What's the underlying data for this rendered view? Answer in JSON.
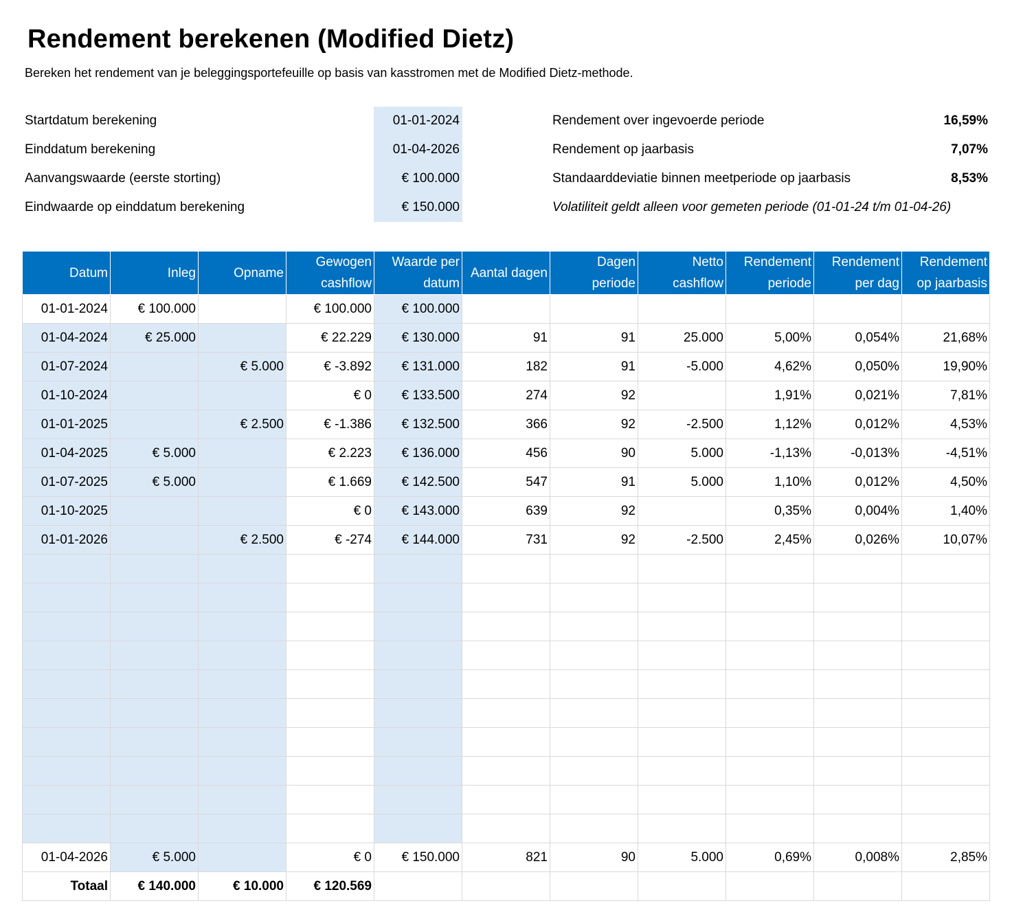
{
  "header": {
    "title": "Rendement berekenen (Modified Dietz)",
    "subtitle": "Bereken het rendement van je beleggingsportefeuille op basis van kasstromen met de Modified Dietz-methode."
  },
  "params": [
    {
      "label": "Startdatum berekening",
      "value": "01-01-2024"
    },
    {
      "label": "Einddatum berekening",
      "value": "01-04-2026"
    },
    {
      "label": "Aanvangswaarde (eerste storting)",
      "value": "€ 100.000"
    },
    {
      "label": "Eindwaarde op einddatum berekening",
      "value": "€ 150.000"
    }
  ],
  "results": [
    {
      "label": "Rendement over ingevoerde periode",
      "value": "16,59%"
    },
    {
      "label": "Rendement op jaarbasis",
      "value": "7,07%"
    },
    {
      "label": "Standaarddeviatie binnen meetperiode op jaarbasis",
      "value": "8,53%"
    }
  ],
  "note": "Volatiliteit geldt alleen voor gemeten periode (01-01-24 t/m 01-04-26)",
  "table": {
    "headers": [
      [
        "Datum"
      ],
      [
        "Inleg"
      ],
      [
        "Opname"
      ],
      [
        "Gewogen",
        "cashflow"
      ],
      [
        "Waarde per",
        "datum"
      ],
      [
        "Aantal dagen"
      ],
      [
        "Dagen",
        "periode"
      ],
      [
        "Netto",
        "cashflow"
      ],
      [
        "Rendement",
        "periode"
      ],
      [
        "Rendement",
        "per dag"
      ],
      [
        "Rendement",
        "op jaarbasis"
      ]
    ],
    "rows": [
      [
        "01-01-2024",
        "€ 100.000",
        "",
        "€ 100.000",
        "€ 100.000",
        "",
        "",
        "",
        "",
        "",
        ""
      ],
      [
        "01-04-2024",
        "€ 25.000",
        "",
        "€ 22.229",
        "€ 130.000",
        "91",
        "91",
        "25.000",
        "5,00%",
        "0,054%",
        "21,68%"
      ],
      [
        "01-07-2024",
        "",
        "€ 5.000",
        "€ -3.892",
        "€ 131.000",
        "182",
        "91",
        "-5.000",
        "4,62%",
        "0,050%",
        "19,90%"
      ],
      [
        "01-10-2024",
        "",
        "",
        "€ 0",
        "€ 133.500",
        "274",
        "92",
        "",
        "1,91%",
        "0,021%",
        "7,81%"
      ],
      [
        "01-01-2025",
        "",
        "€ 2.500",
        "€ -1.386",
        "€ 132.500",
        "366",
        "92",
        "-2.500",
        "1,12%",
        "0,012%",
        "4,53%"
      ],
      [
        "01-04-2025",
        "€ 5.000",
        "",
        "€ 2.223",
        "€ 136.000",
        "456",
        "90",
        "5.000",
        "-1,13%",
        "-0,013%",
        "-4,51%"
      ],
      [
        "01-07-2025",
        "€ 5.000",
        "",
        "€ 1.669",
        "€ 142.500",
        "547",
        "91",
        "5.000",
        "1,10%",
        "0,012%",
        "4,50%"
      ],
      [
        "01-10-2025",
        "",
        "",
        "€ 0",
        "€ 143.000",
        "639",
        "92",
        "",
        "0,35%",
        "0,004%",
        "1,40%"
      ],
      [
        "01-01-2026",
        "",
        "€ 2.500",
        "€ -274",
        "€ 144.000",
        "731",
        "92",
        "-2.500",
        "2,45%",
        "0,026%",
        "10,07%"
      ],
      [
        "",
        "",
        "",
        "",
        "",
        "",
        "",
        "",
        "",
        "",
        ""
      ],
      [
        "",
        "",
        "",
        "",
        "",
        "",
        "",
        "",
        "",
        "",
        ""
      ],
      [
        "",
        "",
        "",
        "",
        "",
        "",
        "",
        "",
        "",
        "",
        ""
      ],
      [
        "",
        "",
        "",
        "",
        "",
        "",
        "",
        "",
        "",
        "",
        ""
      ],
      [
        "",
        "",
        "",
        "",
        "",
        "",
        "",
        "",
        "",
        "",
        ""
      ],
      [
        "",
        "",
        "",
        "",
        "",
        "",
        "",
        "",
        "",
        "",
        ""
      ],
      [
        "",
        "",
        "",
        "",
        "",
        "",
        "",
        "",
        "",
        "",
        ""
      ],
      [
        "",
        "",
        "",
        "",
        "",
        "",
        "",
        "",
        "",
        "",
        ""
      ],
      [
        "",
        "",
        "",
        "",
        "",
        "",
        "",
        "",
        "",
        "",
        ""
      ],
      [
        "",
        "",
        "",
        "",
        "",
        "",
        "",
        "",
        "",
        "",
        ""
      ],
      [
        "01-04-2026",
        "€ 5.000",
        "",
        "€ 0",
        "€ 150.000",
        "821",
        "90",
        "5.000",
        "0,69%",
        "0,008%",
        "2,85%"
      ]
    ],
    "total": [
      "Totaal",
      "€ 140.000",
      "€ 10.000",
      "€ 120.569",
      "",
      "",
      "",
      "",
      "",
      "",
      ""
    ]
  },
  "colors": {
    "header_bg": "#0070c0",
    "input_fill": "#dbe9f7",
    "gridline": "#d9d9d9"
  }
}
